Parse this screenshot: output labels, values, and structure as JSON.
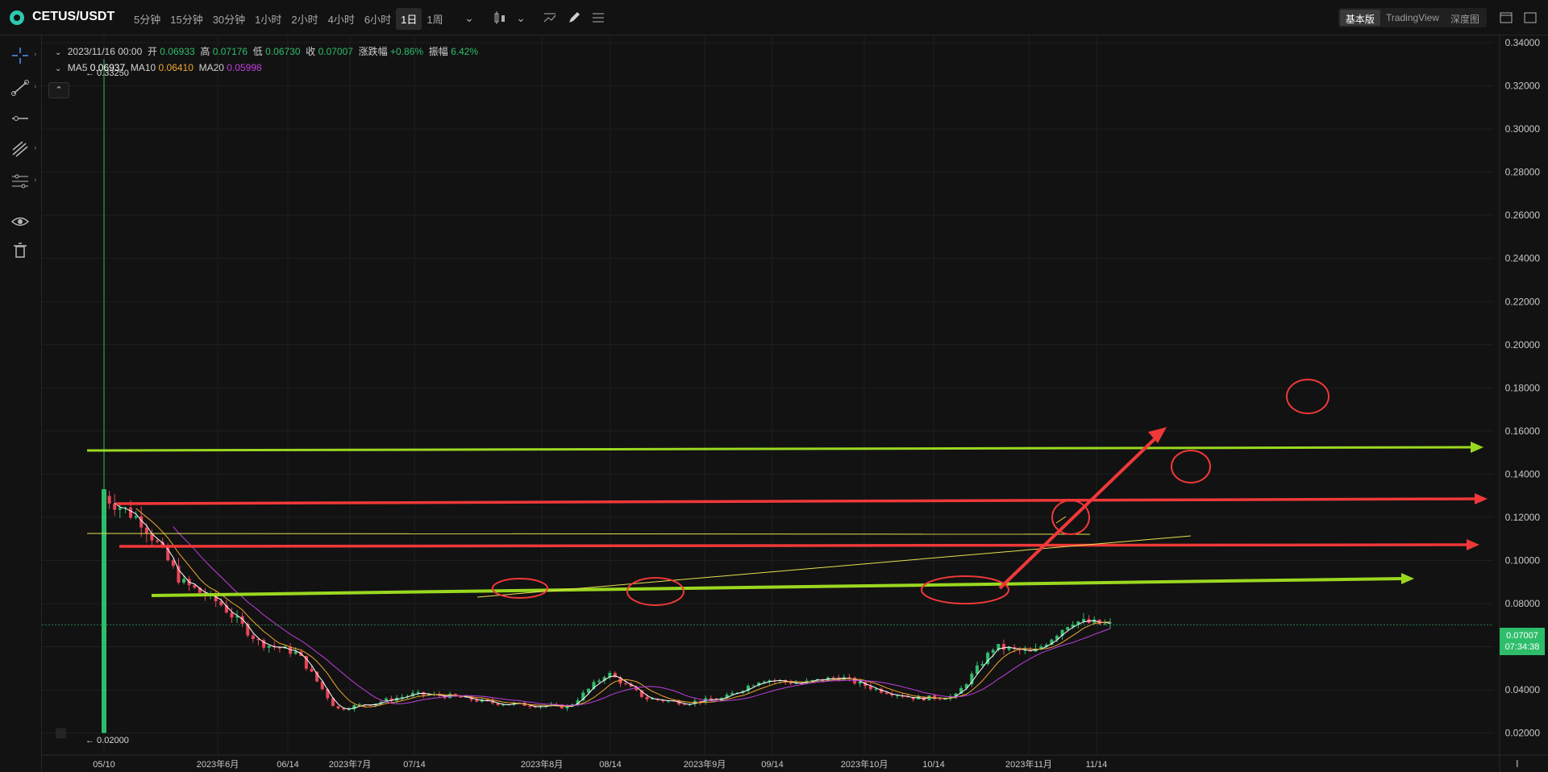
{
  "header": {
    "symbol": "CETUS/USDT",
    "intervals": [
      "5分钟",
      "15分钟",
      "30分钟",
      "1小时",
      "2小时",
      "4小时",
      "6小时",
      "1日",
      "1周"
    ],
    "active_interval": "1日",
    "views": [
      "基本版",
      "TradingView",
      "深度图"
    ],
    "active_view": "基本版"
  },
  "ohlc": {
    "date": "2023/11/16 00:00",
    "open_label": "开",
    "open": "0.06933",
    "high_label": "高",
    "high": "0.07176",
    "low_label": "低",
    "low": "0.06730",
    "close_label": "收",
    "close": "0.07007",
    "change_label": "涨跌幅",
    "change": "+0.86%",
    "amp_label": "振幅",
    "amp": "6.42%"
  },
  "mas": {
    "ma5_label": "MA5",
    "ma5": "0.06937",
    "ma10_label": "MA10",
    "ma10": "0.06410",
    "ma20_label": "MA20",
    "ma20": "0.05998"
  },
  "price_tag": {
    "price": "0.07007",
    "countdown": "07:34:38"
  },
  "markers": {
    "high": "← 0.33250",
    "low": "← 0.02000"
  },
  "colors": {
    "up": "#2ebd6b",
    "down": "#e8455a",
    "ma5": "#ffffff",
    "ma10": "#f0a830",
    "ma20": "#c040e0",
    "arrow_green": "#9ad820",
    "arrow_red": "#f03838"
  },
  "chart_data": {
    "type": "candlestick",
    "y_axis_labels": [
      "0.34000",
      "0.32000",
      "0.30000",
      "0.28000",
      "0.26000",
      "0.24000",
      "0.22000",
      "0.20000",
      "0.18000",
      "0.16000",
      "0.14000",
      "0.12000",
      "0.10000",
      "0.08000",
      "0.06000",
      "0.04000",
      "0.02000"
    ],
    "ylim": [
      0.0135,
      0.3445
    ],
    "x_axis_labels": [
      "05/10",
      "2023年6月",
      "06/14",
      "2023年7月",
      "07/14",
      "2023年8月",
      "08/14",
      "2023年9月",
      "09/14",
      "2023年10月",
      "10/14",
      "2023年11月",
      "11/14"
    ],
    "approx_close_path": [
      [
        "05/10",
        0.13
      ],
      [
        "05/15",
        0.118
      ],
      [
        "05/20",
        0.09
      ],
      [
        "05/25",
        0.08
      ],
      [
        "06/01",
        0.062
      ],
      [
        "06/07",
        0.057
      ],
      [
        "06/14",
        0.031
      ],
      [
        "06/20",
        0.034
      ],
      [
        "06/27",
        0.038
      ],
      [
        "07/05",
        0.037
      ],
      [
        "07/14",
        0.034
      ],
      [
        "07/25",
        0.033
      ],
      [
        "08/01",
        0.032
      ],
      [
        "08/08",
        0.048
      ],
      [
        "08/14",
        0.036
      ],
      [
        "08/20",
        0.034
      ],
      [
        "09/01",
        0.036
      ],
      [
        "09/10",
        0.045
      ],
      [
        "09/20",
        0.043
      ],
      [
        "10/01",
        0.046
      ],
      [
        "10/10",
        0.04
      ],
      [
        "10/16",
        0.036
      ],
      [
        "10/22",
        0.037
      ],
      [
        "11/01",
        0.06
      ],
      [
        "11/08",
        0.057
      ],
      [
        "11/14",
        0.072
      ],
      [
        "11/16",
        0.07
      ]
    ]
  }
}
